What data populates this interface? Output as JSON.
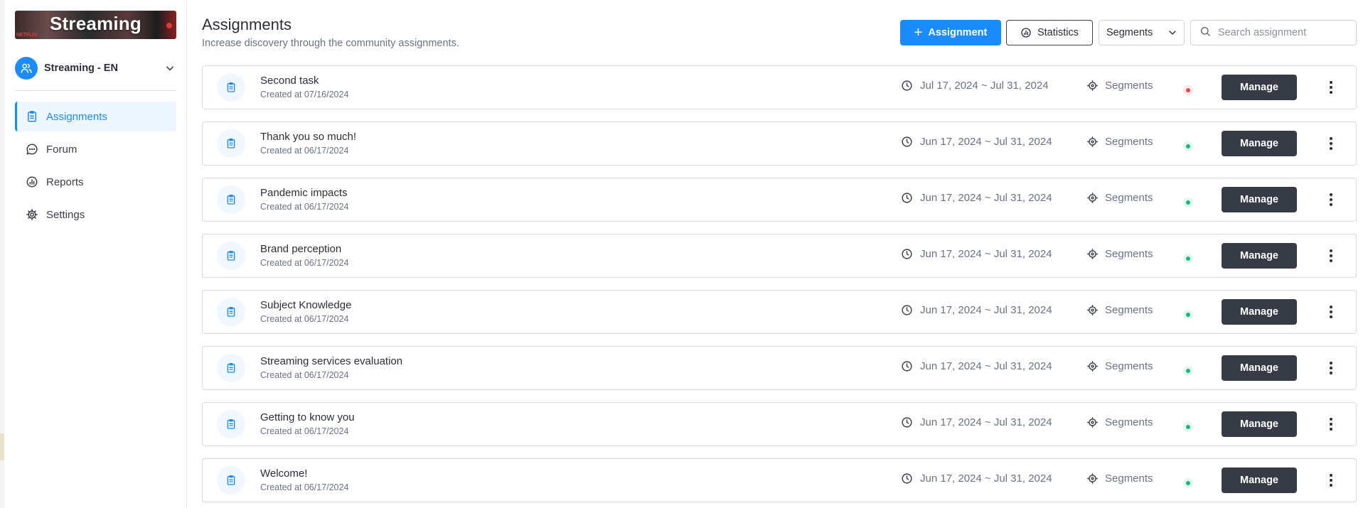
{
  "brand": {
    "logo_text": "Streaming",
    "logo_small_text": "NETFLIX",
    "accent": "#1a8cff",
    "dark": "#363b45"
  },
  "workspace": {
    "name": "Streaming - EN"
  },
  "sidebar": {
    "items": [
      {
        "label": "Assignments",
        "icon": "clipboard-icon",
        "active": true
      },
      {
        "label": "Forum",
        "icon": "chat-icon",
        "active": false
      },
      {
        "label": "Reports",
        "icon": "chart-icon",
        "active": false
      },
      {
        "label": "Settings",
        "icon": "gear-icon",
        "active": false
      }
    ]
  },
  "header": {
    "title": "Assignments",
    "subtitle": "Increase discovery through the community assignments.",
    "add_button": "Assignment",
    "stats_button": "Statistics",
    "segments_select": "Segments",
    "search_placeholder": "Search assignment"
  },
  "assignments": [
    {
      "title": "Second task",
      "created": "Created at 07/16/2024",
      "dates": "Jul 17, 2024 ~ Jul 31, 2024",
      "segments": "Segments",
      "status_color": "#ef4444",
      "status_bg": "#fde8e8",
      "manage": "Manage"
    },
    {
      "title": "Thank you so much!",
      "created": "Created at 06/17/2024",
      "dates": "Jun 17, 2024 ~ Jul 31, 2024",
      "segments": "Segments",
      "status_color": "#10b981",
      "status_bg": "#e3f7ef",
      "manage": "Manage"
    },
    {
      "title": "Pandemic impacts",
      "created": "Created at 06/17/2024",
      "dates": "Jun 17, 2024 ~ Jul 31, 2024",
      "segments": "Segments",
      "status_color": "#10b981",
      "status_bg": "#e3f7ef",
      "manage": "Manage"
    },
    {
      "title": "Brand perception",
      "created": "Created at 06/17/2024",
      "dates": "Jun 17, 2024 ~ Jul 31, 2024",
      "segments": "Segments",
      "status_color": "#10b981",
      "status_bg": "#e3f7ef",
      "manage": "Manage"
    },
    {
      "title": "Subject Knowledge",
      "created": "Created at 06/17/2024",
      "dates": "Jun 17, 2024 ~ Jul 31, 2024",
      "segments": "Segments",
      "status_color": "#10b981",
      "status_bg": "#e3f7ef",
      "manage": "Manage"
    },
    {
      "title": "Streaming services evaluation",
      "created": "Created at 06/17/2024",
      "dates": "Jun 17, 2024 ~ Jul 31, 2024",
      "segments": "Segments",
      "status_color": "#10b981",
      "status_bg": "#e3f7ef",
      "manage": "Manage"
    },
    {
      "title": "Getting to know you",
      "created": "Created at 06/17/2024",
      "dates": "Jun 17, 2024 ~ Jul 31, 2024",
      "segments": "Segments",
      "status_color": "#10b981",
      "status_bg": "#e3f7ef",
      "manage": "Manage"
    },
    {
      "title": "Welcome!",
      "created": "Created at 06/17/2024",
      "dates": "Jun 17, 2024 ~ Jul 31, 2024",
      "segments": "Segments",
      "status_color": "#10b981",
      "status_bg": "#e3f7ef",
      "manage": "Manage"
    }
  ]
}
